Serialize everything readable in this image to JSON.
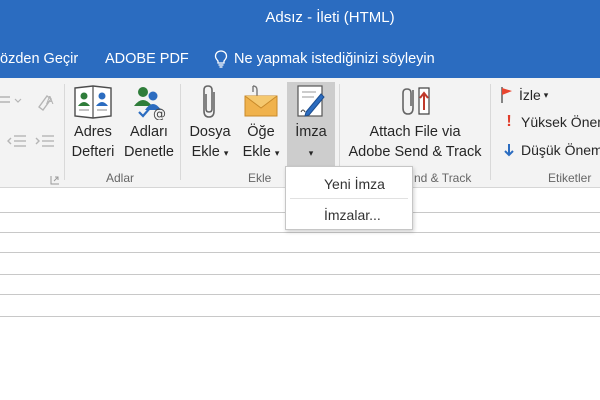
{
  "window": {
    "title": "Adsız  -  İleti (HTML)"
  },
  "tabs": {
    "review": "özden Geçir",
    "adobe": "ADOBE PDF",
    "tell_me": "Ne yapmak istediğinizi söyleyin"
  },
  "ribbon": {
    "names_group": {
      "address_book_l1": "Adres",
      "address_book_l2": "Defteri",
      "check_names_l1": "Adları",
      "check_names_l2": "Denetle",
      "label": "Adlar"
    },
    "include_group": {
      "attach_l1": "Dosya",
      "attach_l2": "Ekle",
      "item_l1": "Öğe",
      "item_l2": "Ekle",
      "signature": "İmza",
      "label": "Ekle"
    },
    "adobe_group": {
      "l1": "Attach File via",
      "l2": "Adobe Send & Track",
      "label": "nd & Track"
    },
    "tags_group": {
      "follow": "İzle",
      "high": "Yüksek Önem",
      "low": "Düşük Önem",
      "label": "Etiketler"
    }
  },
  "signature_menu": {
    "new": "Yeni İmza",
    "list": "İmzalar..."
  },
  "colors": {
    "accent": "#2b6cc0",
    "flag": "#e8452f"
  }
}
